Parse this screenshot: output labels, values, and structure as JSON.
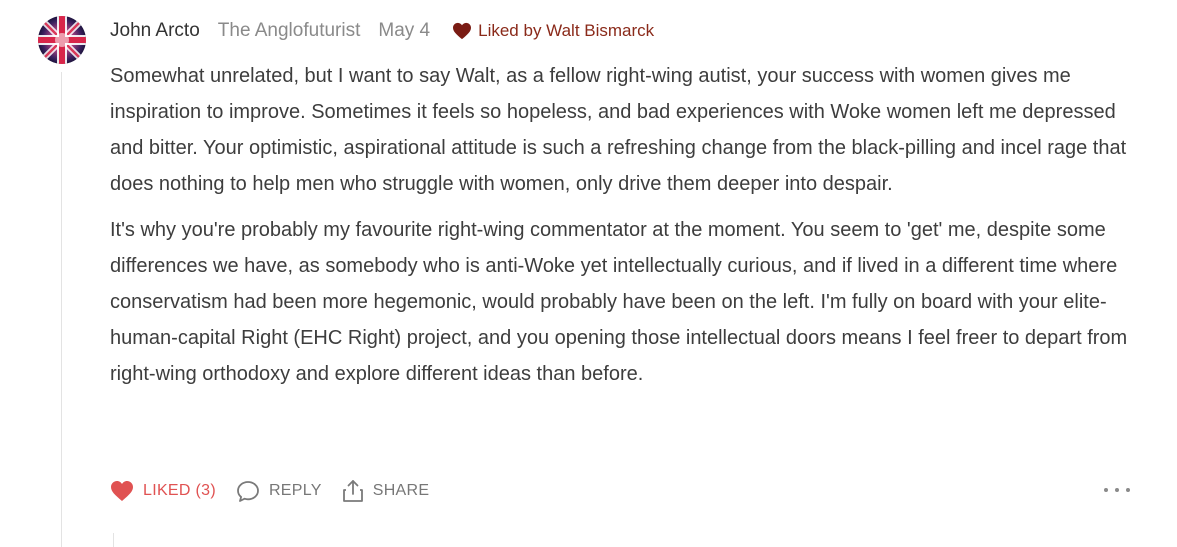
{
  "comment": {
    "author": "John Arcto",
    "publication": "The Anglofuturist",
    "date": "May 4",
    "liked_by": "Liked by Walt Bismarck",
    "paragraphs": [
      "Somewhat unrelated, but I want to say Walt, as a fellow right-wing autist, your success with women gives me inspiration to improve. Sometimes it feels so hopeless, and bad experiences with Woke women left me depressed and bitter. Your optimistic, aspirational attitude is such a refreshing change from the black-pilling and incel rage that does nothing to help men who struggle with women, only drive them deeper into despair.",
      "It's why you're probably my favourite right-wing commentator at the moment. You seem to 'get' me, despite some differences we have, as somebody who is anti-Woke yet intellectually curious, and if lived in a different time where conservatism had been more hegemonic, would probably have been on the left. I'm fully on board with your elite-human-capital Right (EHC Right) project, and you opening those intellectual doors means I feel freer to depart from right-wing orthodoxy and explore different ideas than before."
    ]
  },
  "actions": {
    "liked_label": "LIKED (3)",
    "reply_label": "REPLY",
    "share_label": "SHARE"
  },
  "icons": {
    "avatar": "union-jack-avatar",
    "liked_by": "heart-icon",
    "like": "heart-icon",
    "reply": "speech-bubble-icon",
    "share": "share-upload-icon",
    "more": "ellipsis-icon"
  },
  "colors": {
    "liked_accent": "#e05252",
    "liked_by_text": "#8a2a1a",
    "muted_text": "#8a8a8a",
    "body_text": "#3d3d3d"
  }
}
